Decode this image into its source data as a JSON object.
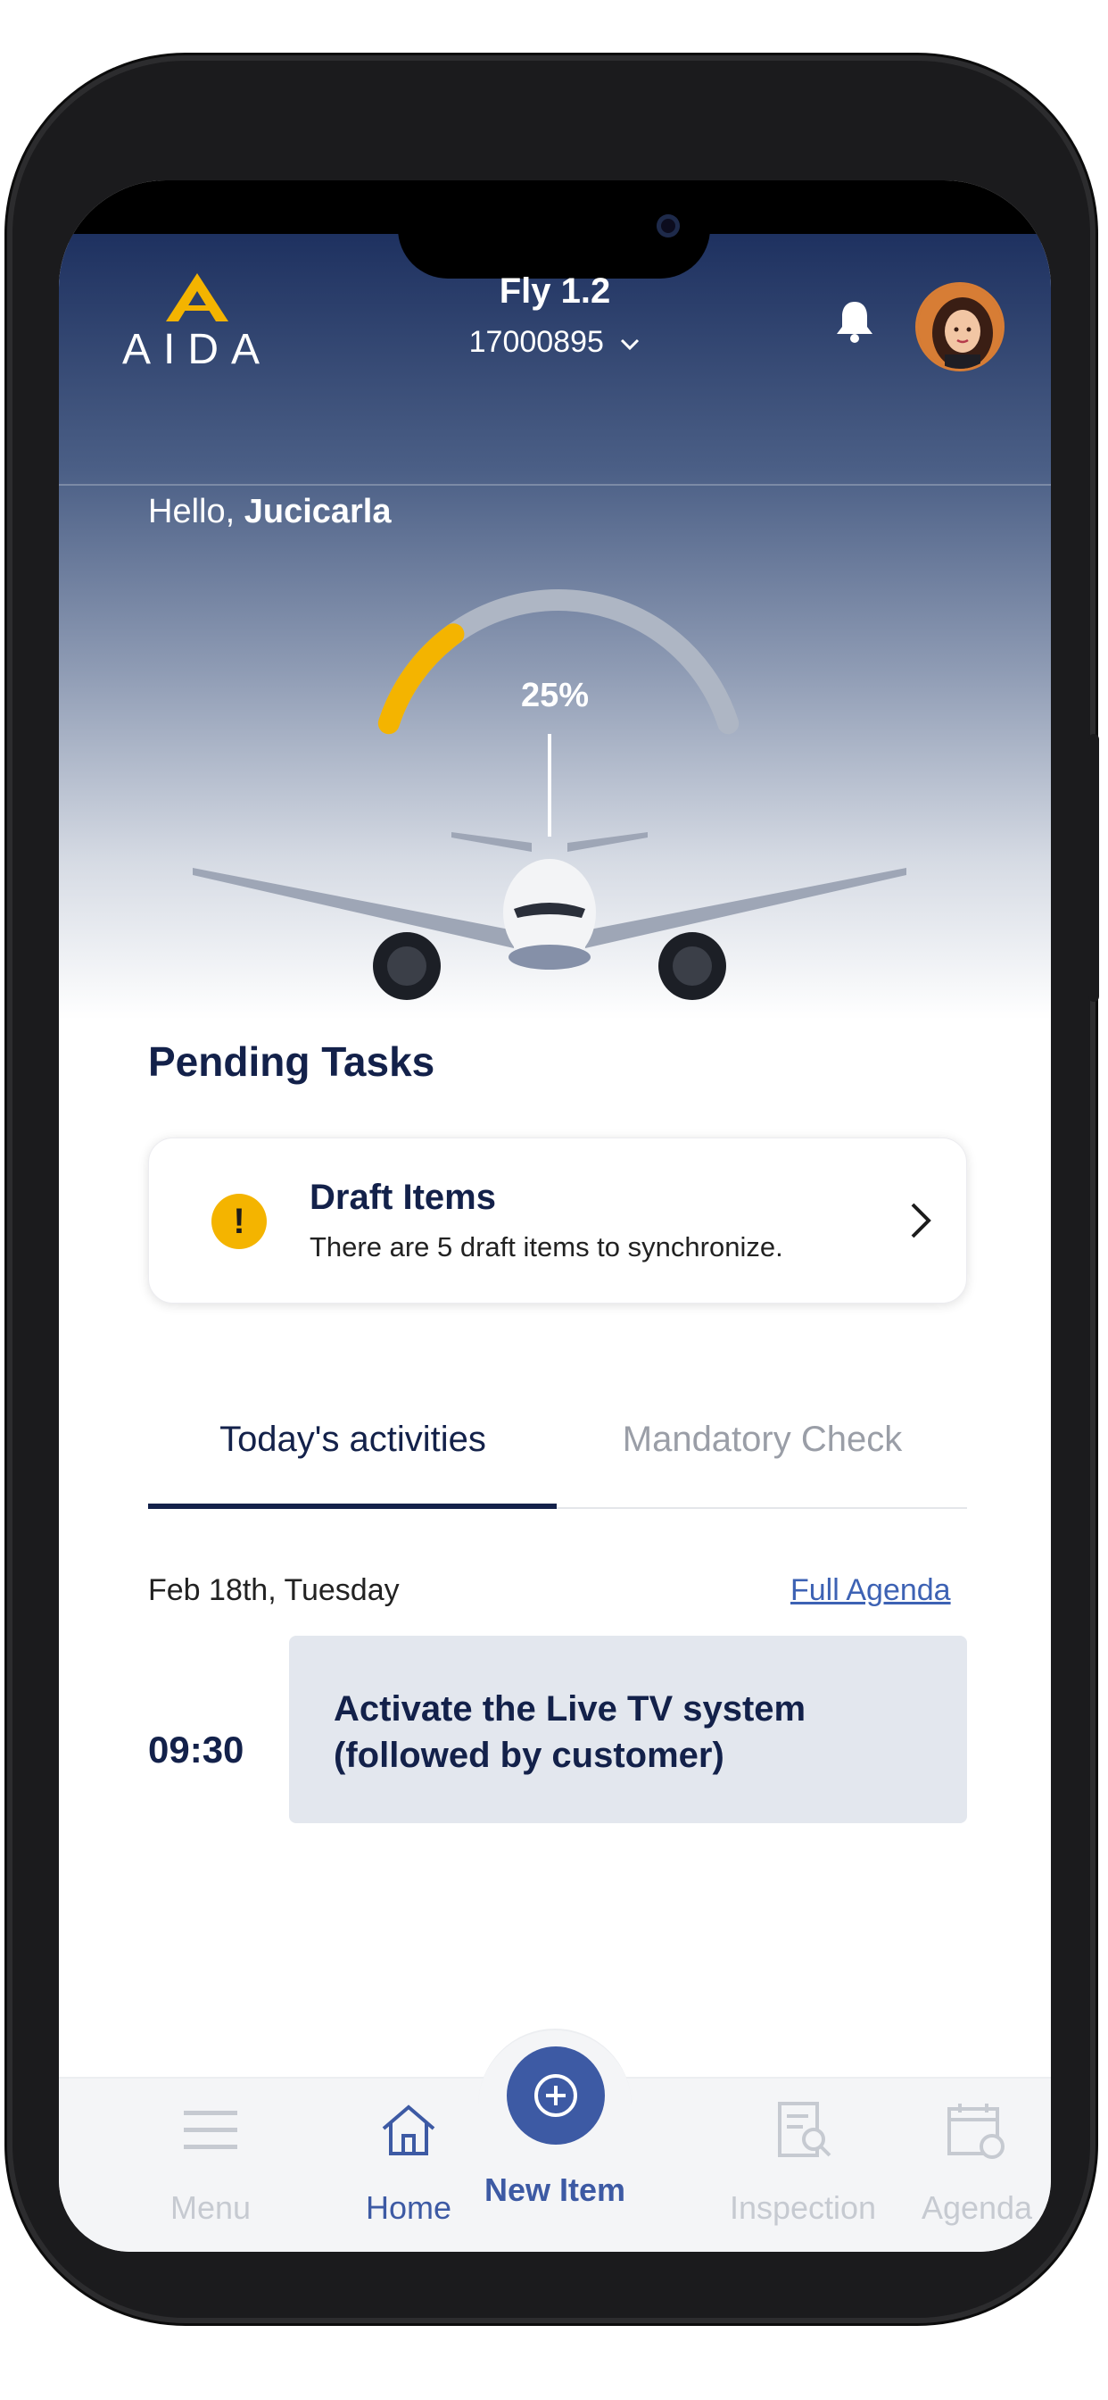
{
  "header": {
    "logo_text": "AIDA",
    "app_title": "Fly 1.2",
    "flight_number": "17000895",
    "notification_icon": "bell-icon",
    "avatar_icon": "user-avatar"
  },
  "greeting": {
    "prefix": "Hello, ",
    "name": "Jucicarla"
  },
  "progress": {
    "label": "25%",
    "value": 0.25,
    "accent_color": "#f4b400",
    "track_color": "#aeb6c4"
  },
  "pending_tasks": {
    "title": "Pending Tasks",
    "draft_card": {
      "icon": "warning-icon",
      "title": "Draft Items",
      "description": "There are 5 draft items to synchronize."
    }
  },
  "tabs": [
    {
      "label": "Today's activities",
      "active": true
    },
    {
      "label": "Mandatory Check",
      "active": false
    }
  ],
  "agenda": {
    "date": "Feb 18th, Tuesday",
    "full_agenda_link": "Full Agenda",
    "activities": [
      {
        "time": "09:30",
        "title": "Activate the Live TV system (followed by customer)"
      }
    ]
  },
  "bottom_nav": {
    "items": [
      {
        "label": "Menu",
        "icon": "menu-icon",
        "active": false
      },
      {
        "label": "Home",
        "icon": "home-icon",
        "active": true
      },
      {
        "label": "New Item",
        "icon": "plus-circle-icon",
        "active": true
      },
      {
        "label": "Inspection",
        "icon": "inspection-icon",
        "active": false
      },
      {
        "label": "Agenda",
        "icon": "calendar-icon",
        "active": false
      }
    ]
  },
  "colors": {
    "primary_navy": "#13214a",
    "accent_blue": "#3d5aa4",
    "warning_yellow": "#f4b400"
  }
}
